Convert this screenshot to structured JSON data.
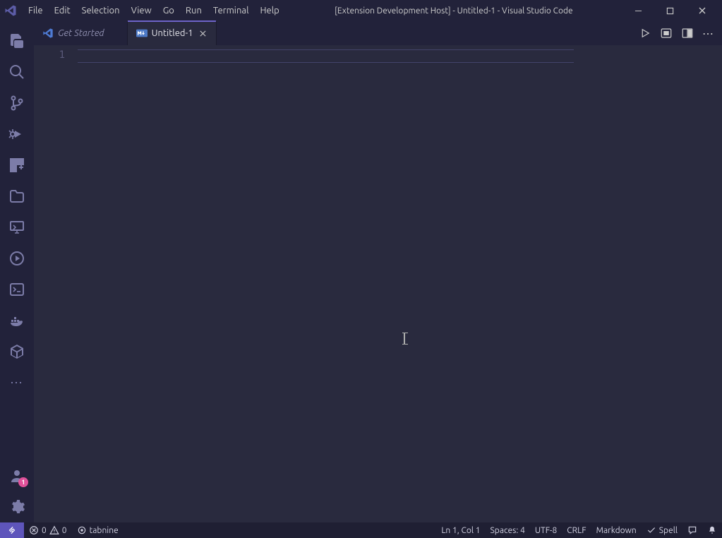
{
  "window": {
    "title": "[Extension Development Host] - Untitled-1 - Visual Studio Code"
  },
  "menubar": [
    "File",
    "Edit",
    "Selection",
    "View",
    "Go",
    "Run",
    "Terminal",
    "Help"
  ],
  "activity_bar": {
    "account_badge": "1"
  },
  "tabs": {
    "get_started": {
      "label": "Get Started"
    },
    "untitled": {
      "label": "Untitled-1"
    }
  },
  "editor": {
    "line_number_1": "1"
  },
  "status": {
    "errors": "0",
    "warnings": "0",
    "tabnine": "tabnine",
    "position": "Ln 1, Col 1",
    "indent": "Spaces: 4",
    "encoding": "UTF-8",
    "eol": "CRLF",
    "language": "Markdown",
    "spell": "Spell"
  }
}
